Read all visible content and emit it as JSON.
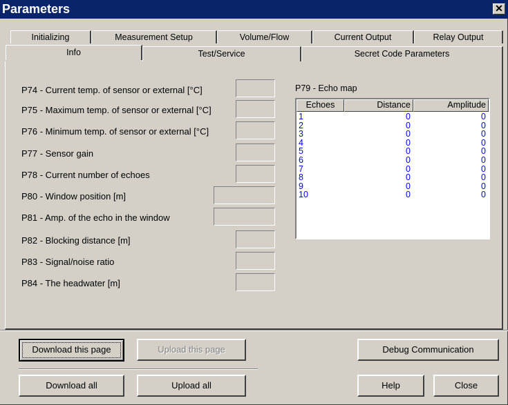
{
  "window": {
    "title": "Parameters",
    "close_glyph": "✕"
  },
  "tabs_row1": [
    "Initializing",
    "Measurement Setup",
    "Volume/Flow",
    "Current Output",
    "Relay Output"
  ],
  "tabs_row2": [
    "Info",
    "Test/Service",
    "Secret Code Parameters"
  ],
  "params": [
    {
      "label": "P74 - Current temp. of sensor or external [°C]",
      "value": ""
    },
    {
      "label": "P75 - Maximum temp. of sensor or external [°C]",
      "value": ""
    },
    {
      "label": "P76 - Minimum temp. of sensor or external [°C]",
      "value": ""
    },
    {
      "label": "P77 - Sensor gain",
      "value": ""
    },
    {
      "label": "P78 - Current number of echoes",
      "value": ""
    },
    {
      "label": "P80 - Window position [m]",
      "value": ""
    },
    {
      "label": "P81 - Amp. of the echo in the window",
      "value": ""
    },
    {
      "label": "P82 - Blocking distance [m]",
      "value": ""
    },
    {
      "label": "P83 - Signal/noise ratio",
      "value": ""
    },
    {
      "label": "P84 - The headwater [m]",
      "value": ""
    }
  ],
  "echo_map": {
    "title": "P79 - Echo map",
    "columns": [
      "Echoes",
      "Distance",
      "Amplitude"
    ],
    "rows": [
      [
        "1",
        "0",
        "0"
      ],
      [
        "2",
        "0",
        "0"
      ],
      [
        "3",
        "0",
        "0"
      ],
      [
        "4",
        "0",
        "0"
      ],
      [
        "5",
        "0",
        "0"
      ],
      [
        "6",
        "0",
        "0"
      ],
      [
        "7",
        "0",
        "0"
      ],
      [
        "8",
        "0",
        "0"
      ],
      [
        "9",
        "0",
        "0"
      ],
      [
        "10",
        "0",
        "0"
      ]
    ]
  },
  "buttons": {
    "download_page": "Download this page",
    "upload_page": "Upload this page",
    "debug": "Debug Communication",
    "download_all": "Download all",
    "upload_all": "Upload all",
    "help": "Help",
    "close": "Close"
  },
  "colors": {
    "titlebar": "#0a246a",
    "face": "#d4d0c8",
    "link_text": "#0000ff"
  }
}
